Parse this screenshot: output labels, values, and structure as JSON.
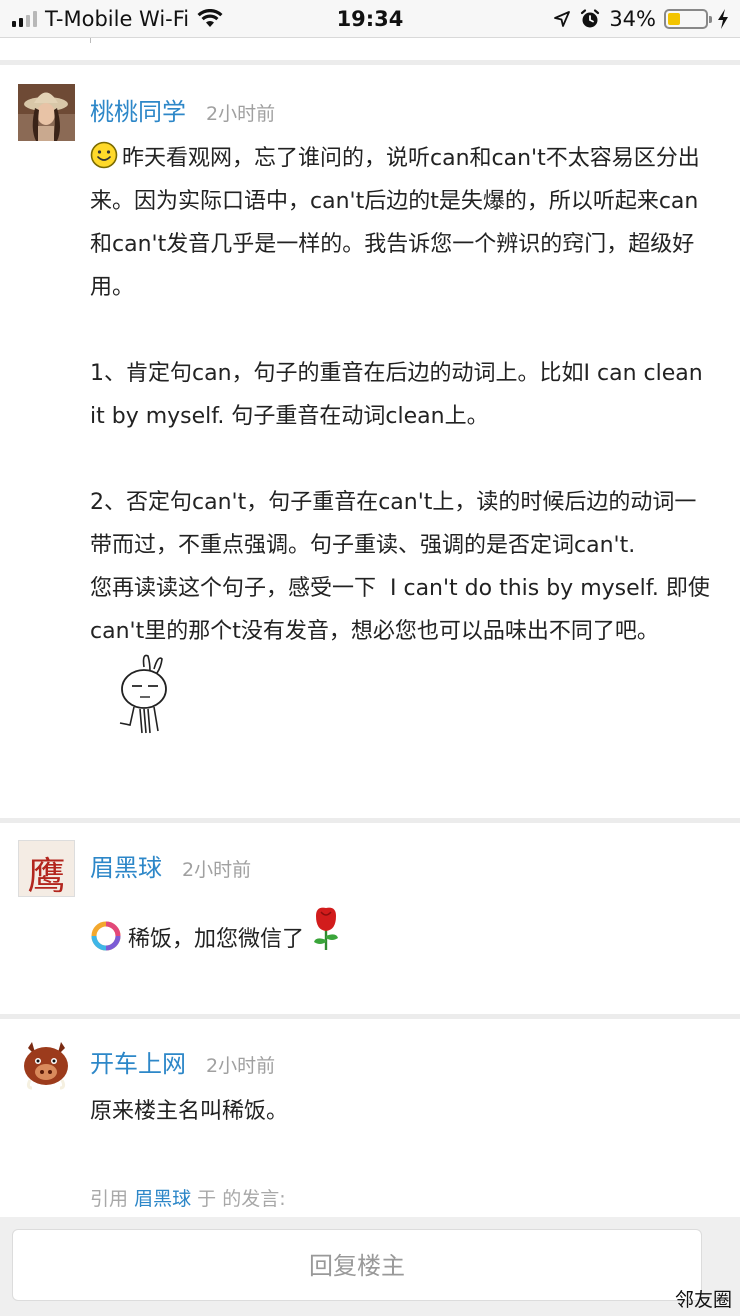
{
  "status_bar": {
    "carrier": "T-Mobile Wi-Fi",
    "time": "19:34",
    "battery_percent": "34%",
    "battery_level": 0.34,
    "battery_color": "#f3c400"
  },
  "posts": [
    {
      "author": "桃桃同学",
      "time": "2小时前",
      "avatar_icon": "woman-in-hat-avatar",
      "leading_icon": "smiley-face-emoji",
      "paragraphs": [
        "昨天看观网，忘了谁问的，说听can和can't不太容易区分出来。因为实际口语中，can't后边的t是失爆的，所以听起来can和can't发音几乎是一样的。我告诉您一个辨识的窍门，超级好用。",
        "1、肯定句can，句子的重音在后边的动词上。比如I can clean it by myself. 句子重音在动词clean上。",
        "2、否定句can't，句子重音在can't上，读的时候后边的动词一带而过，不重点强调。句子重读、强调的是否定词can't.\n您再读读这个句子，感受一下  I can't do this by myself. 即使can't里的那个t没有发音，想必您也可以品味出不同了吧。"
      ],
      "trailing_icon": "bunny-sticker"
    },
    {
      "author": "眉黑球",
      "time": "2小时前",
      "avatar_icon": "calligraphy-avatar",
      "avatar_char": "鹰",
      "leading_icon": "colorful-ring-emoji",
      "text": "稀饭，加您微信了",
      "trailing_icon": "rose-emoji"
    },
    {
      "author": "开车上网",
      "time": "2小时前",
      "avatar_icon": "cartoon-pig-avatar",
      "text": "原来楼主名叫稀饭。"
    }
  ],
  "quote": {
    "prefix": "引用",
    "user": "眉黑球",
    "middle": "于",
    "suffix": "的发言:"
  },
  "reply_button": "回复楼主",
  "watermark": "邻友圈",
  "colors": {
    "link_blue": "#2d87c8",
    "muted_gray": "#a0a0a0"
  }
}
